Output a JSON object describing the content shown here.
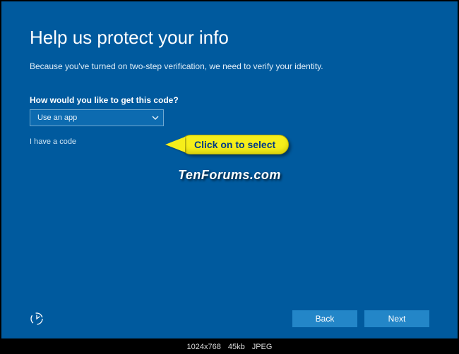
{
  "page": {
    "title": "Help us protect your info",
    "subtitle": "Because you've turned on two-step verification, we need to verify your identity."
  },
  "field": {
    "label": "How would you like to get this code?",
    "selected": "Use an app"
  },
  "links": {
    "have_code": "I have a code"
  },
  "annotation": {
    "text": "Click on to select"
  },
  "watermark": "TenForums.com",
  "buttons": {
    "back": "Back",
    "next": "Next"
  },
  "status": {
    "dimensions": "1024x768",
    "size": "45kb",
    "format": "JPEG"
  }
}
